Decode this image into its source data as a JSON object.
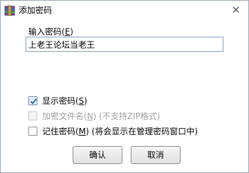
{
  "window": {
    "title": "添加密码",
    "icon": "winrar-icon",
    "close_icon": "close-icon"
  },
  "password": {
    "label": "输入密码(",
    "label_hotkey": "E",
    "label_end": ")",
    "value": "上老王论坛当老王"
  },
  "options": {
    "show_password": {
      "label": "显示密码(",
      "hotkey": "S",
      "end": ")",
      "checked": true,
      "enabled": true
    },
    "encrypt_names": {
      "label": "加密文件名(",
      "hotkey": "N",
      "end": ")",
      "note": " (不支持ZIP格式)",
      "checked": false,
      "enabled": false
    },
    "remember_password": {
      "label": "记住密码(",
      "hotkey": "M",
      "end": ")",
      "note": " (将会显示在管理密码窗口中)",
      "checked": false,
      "enabled": true
    }
  },
  "buttons": {
    "ok_label": "确认",
    "cancel_label": "取消"
  },
  "colors": {
    "checkmark": "#1c5fb0",
    "border": "#9aa6b4"
  }
}
